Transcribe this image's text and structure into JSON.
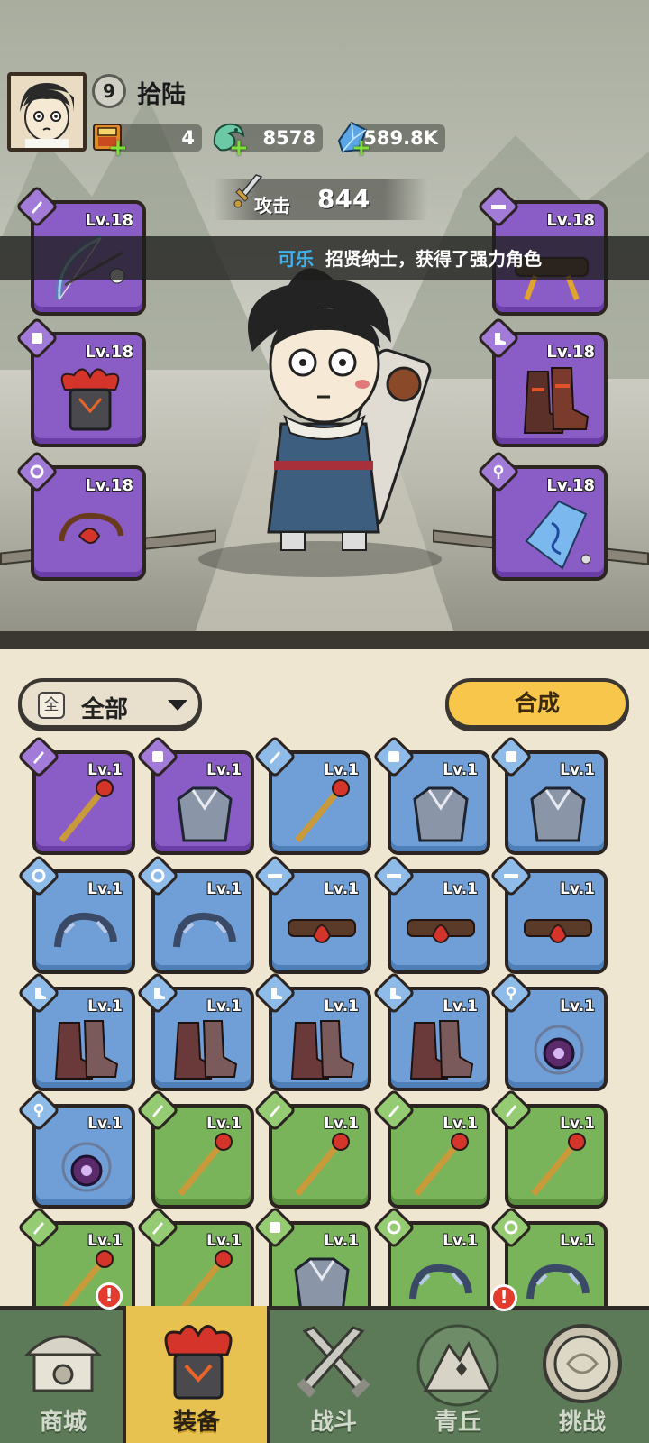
{
  "player": {
    "level": "9",
    "name": "拾陆"
  },
  "resources": [
    {
      "icon": "scroll-ticket-icon",
      "value": "4"
    },
    {
      "icon": "jade-dragon-icon",
      "value": "8578"
    },
    {
      "icon": "crystal-icon",
      "value": "589.8K"
    }
  ],
  "attack": {
    "label": "攻击",
    "value": "844"
  },
  "marquee": {
    "name": "可乐",
    "text": "招贤纳士，获得了强力角色"
  },
  "equipped": {
    "left": [
      {
        "slot": "weapon",
        "item": "bow-icon",
        "level": "Lv.18"
      },
      {
        "slot": "armor",
        "item": "helmet-icon",
        "level": "Lv.18"
      },
      {
        "slot": "ring",
        "item": "bracelet-icon",
        "level": "Lv.18"
      }
    ],
    "right": [
      {
        "slot": "belt",
        "item": "belt-icon",
        "level": "Lv.18"
      },
      {
        "slot": "boots",
        "item": "boots-icon",
        "level": "Lv.18"
      },
      {
        "slot": "amulet",
        "item": "pendant-icon",
        "level": "Lv.18"
      }
    ]
  },
  "inventory": {
    "filter_chip": "全",
    "filter_label": "全部",
    "craft_label": "合成",
    "items": [
      {
        "rarity": "purple",
        "slot": "weapon",
        "item": "staff-icon",
        "level": "Lv.1"
      },
      {
        "rarity": "purple",
        "slot": "armor",
        "item": "chestplate-icon",
        "level": "Lv.1"
      },
      {
        "rarity": "blue",
        "slot": "weapon",
        "item": "hammer-icon",
        "level": "Lv.1"
      },
      {
        "rarity": "blue",
        "slot": "armor",
        "item": "ice-armor-icon",
        "level": "Lv.1"
      },
      {
        "rarity": "blue",
        "slot": "armor",
        "item": "ice-armor-icon",
        "level": "Lv.1"
      },
      {
        "rarity": "blue",
        "slot": "ring",
        "item": "claw-bracelet-icon",
        "level": "Lv.1"
      },
      {
        "rarity": "blue",
        "slot": "ring",
        "item": "thorn-bracelet-icon",
        "level": "Lv.1"
      },
      {
        "rarity": "blue",
        "slot": "belt",
        "item": "lotus-belt-icon",
        "level": "Lv.1"
      },
      {
        "rarity": "blue",
        "slot": "belt",
        "item": "lotus-belt-icon",
        "level": "Lv.1"
      },
      {
        "rarity": "blue",
        "slot": "belt",
        "item": "frost-belt-icon",
        "level": "Lv.1"
      },
      {
        "rarity": "blue",
        "slot": "boots",
        "item": "flame-boots-icon",
        "level": "Lv.1"
      },
      {
        "rarity": "blue",
        "slot": "boots",
        "item": "frost-boots-icon",
        "level": "Lv.1"
      },
      {
        "rarity": "blue",
        "slot": "boots",
        "item": "shadow-boots-icon",
        "level": "Lv.1"
      },
      {
        "rarity": "blue",
        "slot": "boots",
        "item": "gold-boots-icon",
        "level": "Lv.1"
      },
      {
        "rarity": "blue",
        "slot": "amulet",
        "item": "orb-amulet-icon",
        "level": "Lv.1"
      },
      {
        "rarity": "blue",
        "slot": "amulet",
        "item": "fang-necklace-icon",
        "level": "Lv.1"
      },
      {
        "rarity": "green",
        "slot": "weapon",
        "item": "flower-mace-icon",
        "level": "Lv.1"
      },
      {
        "rarity": "green",
        "slot": "weapon",
        "item": "flower-mace-icon",
        "level": "Lv.1"
      },
      {
        "rarity": "green",
        "slot": "weapon",
        "item": "bow-icon",
        "level": "Lv.1"
      },
      {
        "rarity": "green",
        "slot": "weapon",
        "item": "bow-icon",
        "level": "Lv.1"
      },
      {
        "rarity": "green",
        "slot": "weapon",
        "item": "crossbow-icon",
        "level": "Lv.1"
      },
      {
        "rarity": "green",
        "slot": "weapon",
        "item": "staff-icon",
        "level": "Lv.1"
      },
      {
        "rarity": "green",
        "slot": "armor",
        "item": "bone-armor-icon",
        "level": "Lv.1"
      },
      {
        "rarity": "green",
        "slot": "ring",
        "item": "vine-bracelet-icon",
        "level": "Lv.1"
      },
      {
        "rarity": "green",
        "slot": "ring",
        "item": "ice-bracelet-icon",
        "level": "Lv.1"
      }
    ]
  },
  "nav": [
    {
      "label": "商城",
      "icon": "shop-icon",
      "alert": true
    },
    {
      "label": "装备",
      "icon": "equipment-helmet-icon",
      "active": true
    },
    {
      "label": "战斗",
      "icon": "crossed-swords-icon"
    },
    {
      "label": "青丘",
      "icon": "mountain-icon",
      "alert": true
    },
    {
      "label": "挑战",
      "icon": "challenge-drum-icon"
    }
  ],
  "alert_glyph": "!"
}
